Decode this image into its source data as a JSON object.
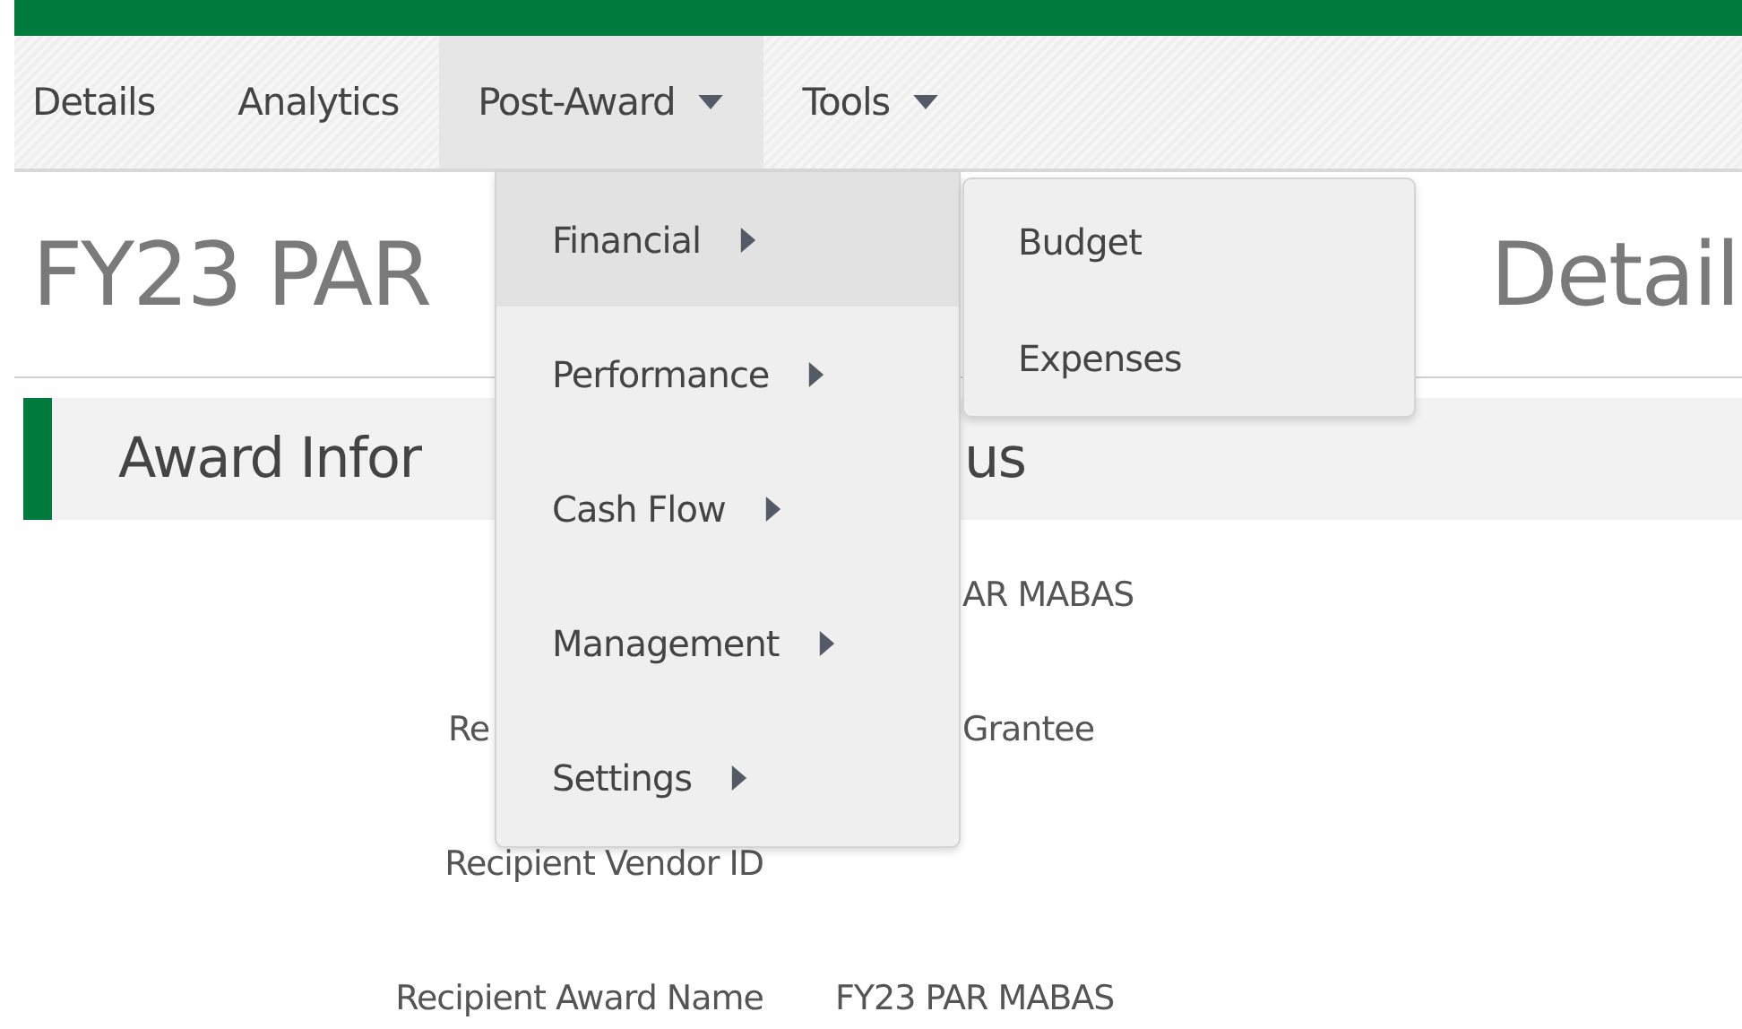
{
  "nav": {
    "items": [
      {
        "label": "Details",
        "dropdown": false,
        "selected": false
      },
      {
        "label": "Analytics",
        "dropdown": false,
        "selected": false
      },
      {
        "label": "Post-Award",
        "dropdown": true,
        "selected": true
      },
      {
        "label": "Tools",
        "dropdown": true,
        "selected": false
      }
    ]
  },
  "title": {
    "start": "FY23 PAR",
    "end": "Detail"
  },
  "section": {
    "start": "Award Infor",
    "end": "us"
  },
  "fields": [
    {
      "value": "AR MABAS",
      "value_cut": true
    },
    {
      "label": "Re",
      "label_cut": true,
      "value": "Grantee",
      "value_cut": true
    },
    {
      "label": "Recipient Vendor ID"
    },
    {
      "label": "Recipient Award Name",
      "value": "FY23 PAR MABAS"
    }
  ],
  "menu": {
    "items": [
      {
        "label": "Financial",
        "selected": true
      },
      {
        "label": "Performance",
        "selected": false
      },
      {
        "label": "Cash Flow",
        "selected": false
      },
      {
        "label": "Management",
        "selected": false
      },
      {
        "label": "Settings",
        "selected": false
      }
    ]
  },
  "submenu": {
    "items": [
      {
        "label": "Budget"
      },
      {
        "label": "Expenses"
      }
    ]
  }
}
